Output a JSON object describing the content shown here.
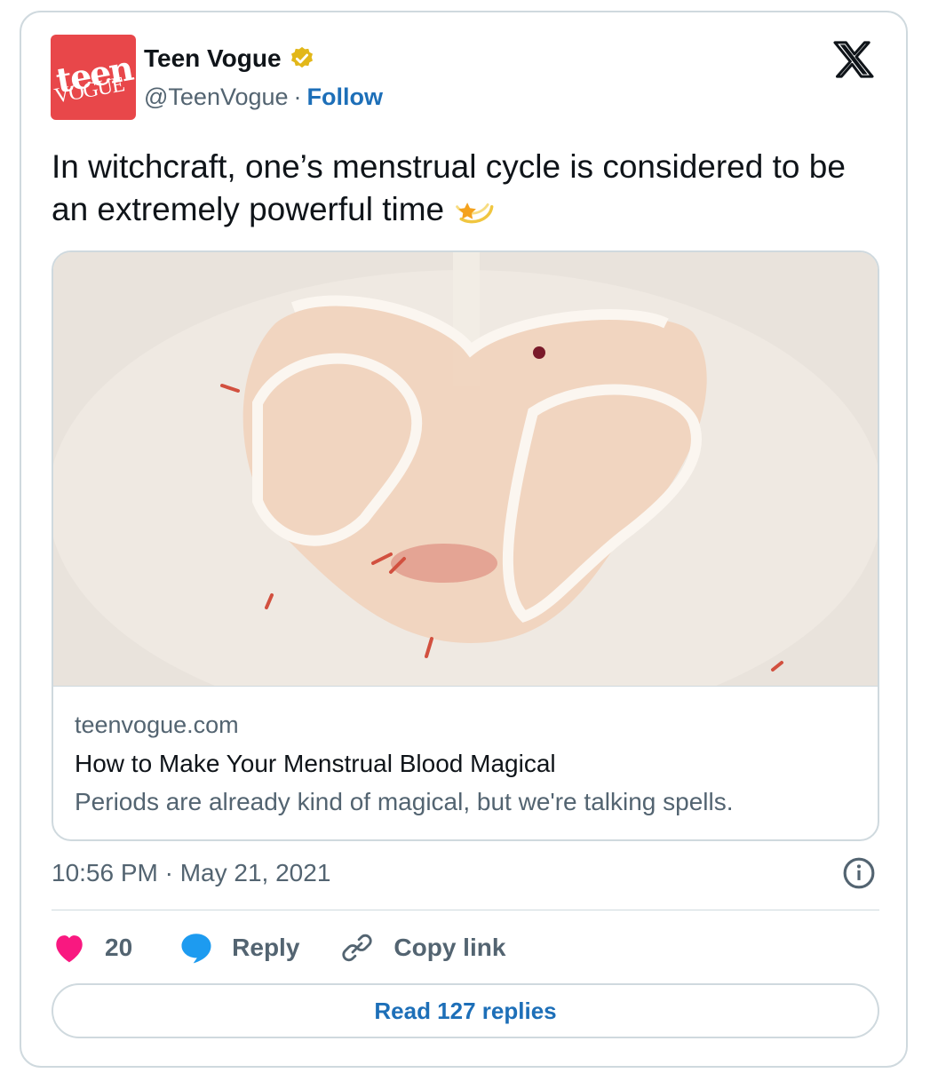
{
  "author": {
    "avatar_text_line1": "teen",
    "avatar_text_line2": "VOGUE",
    "name": "Teen Vogue",
    "handle": "@TeenVogue",
    "separator": "·",
    "follow_label": "Follow",
    "verified_icon": "gold-verified-badge-icon"
  },
  "platform_icon": "x-logo-icon",
  "tweet": {
    "text": "In witchcraft, one’s menstrual cycle is considered to be an extremely powerful time",
    "emoji": "dizzy-star-emoji"
  },
  "link_card": {
    "domain": "teenvogue.com",
    "title": "How to Make Your Menstrual Blood Magical",
    "description": "Periods are already kind of magical, but we're talking spells."
  },
  "meta": {
    "timestamp": "10:56 PM · May 21, 2021",
    "info_icon": "info-icon"
  },
  "actions": {
    "like_count": "20",
    "reply_label": "Reply",
    "copy_link_label": "Copy link"
  },
  "read_replies_label": "Read 127 replies",
  "colors": {
    "link_blue": "#1d6fb8",
    "like_pink": "#f91880",
    "reply_blue": "#1d9bf0",
    "avatar_red": "#e8474a",
    "muted_text": "#536471",
    "border": "#cfd9de"
  }
}
